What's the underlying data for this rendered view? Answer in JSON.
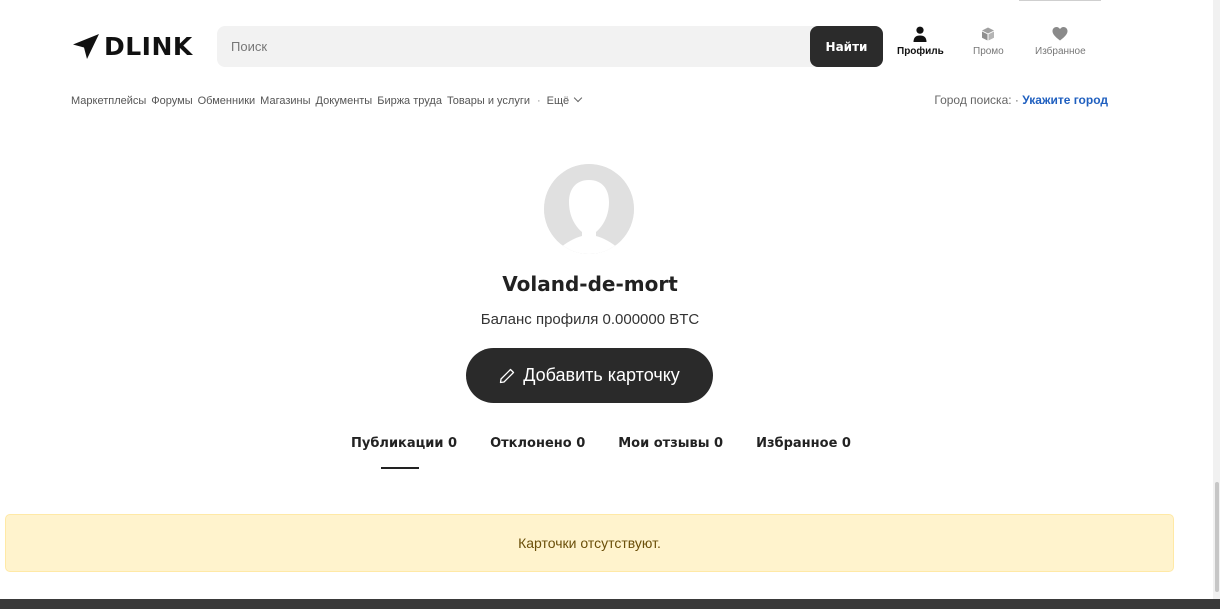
{
  "header": {
    "logo_text": "DLINK",
    "search_placeholder": "Поиск",
    "search_button": "Найти",
    "nav": [
      {
        "label": "Профиль",
        "icon": "user-icon",
        "active": true
      },
      {
        "label": "Промо",
        "icon": "box-icon",
        "active": false
      },
      {
        "label": "Избранное",
        "icon": "heart-icon",
        "active": false
      }
    ]
  },
  "categories": [
    "Маркетплейсы",
    "Форумы",
    "Обменники",
    "Магазины",
    "Документы",
    "Биржа труда",
    "Товары и услуги"
  ],
  "more_label": "Ещё",
  "city": {
    "label": "Город поиска: ·",
    "link": "Укажите город"
  },
  "profile": {
    "username": "Voland-de-mort",
    "balance": "Баланс профиля 0.000000 BTC",
    "add_button": "Добавить карточку"
  },
  "tabs": [
    {
      "label": "Публикации 0",
      "active": true
    },
    {
      "label": "Отклонено 0",
      "active": false
    },
    {
      "label": "Мои отзывы 0",
      "active": false
    },
    {
      "label": "Избранное 0",
      "active": false
    }
  ],
  "alert": "Карточки отсутствуют.",
  "colors": {
    "accent_dark": "#2a2a2a",
    "link_blue": "#1f5fbf",
    "alert_bg": "#fff3cd",
    "alert_text": "#6b4f0a"
  }
}
